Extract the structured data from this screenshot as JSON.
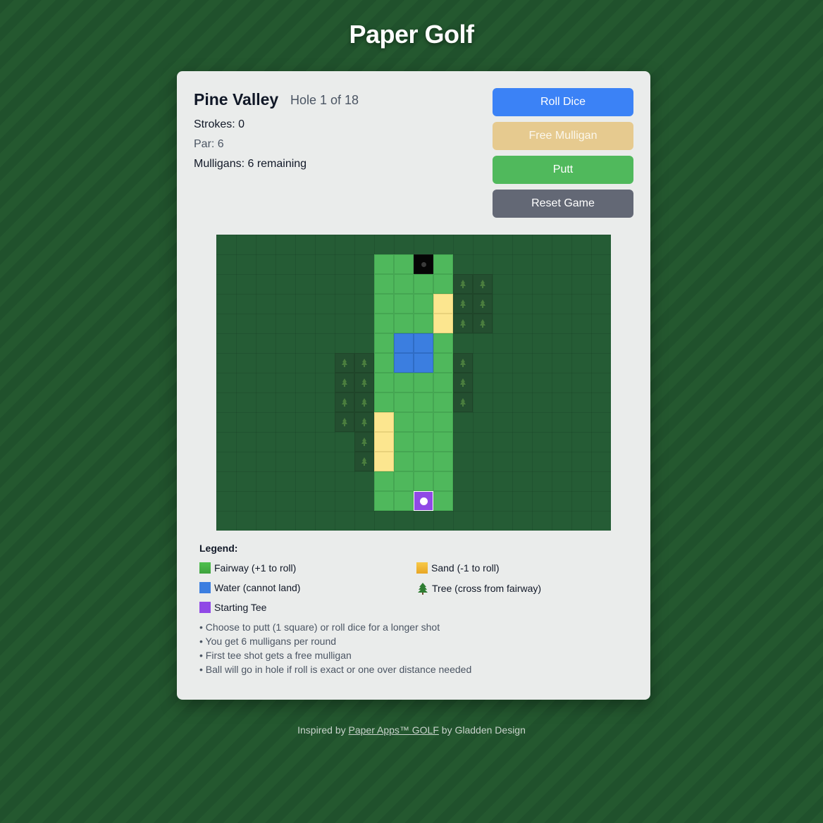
{
  "app": {
    "title": "Paper Golf"
  },
  "course": {
    "name": "Pine Valley",
    "hole_info": "Hole 1 of 18"
  },
  "stats": {
    "strokes": "Strokes: 0",
    "par": "Par: 6",
    "mulligans": "Mulligans: 6 remaining"
  },
  "buttons": {
    "roll": "Roll Dice",
    "mulligan": "Free Mulligan",
    "putt": "Putt",
    "reset": "Reset Game"
  },
  "colors": {
    "fairway": "#4fb85c",
    "sand": "#fce68f",
    "water": "#3b7ee0",
    "tree": "#244f30",
    "hole": "#050505",
    "tee": "#9049e6",
    "rough": "#255c35"
  },
  "board": {
    "cols": 20,
    "rows": 15,
    "grid": [
      "....................",
      "........FFHF........",
      "........FFFFTT......",
      "........FFFSTT......",
      "........FFFSTT......",
      "........FWWF........",
      "......TTFWWFT.......",
      "......TTFFFFT.......",
      "......TTFFFFT.......",
      "......TTSFFF........",
      ".......TSFFF........",
      ".......TSFFF........",
      "........FFFF........",
      "........FFEF........",
      "...................."
    ],
    "tree_icon": "tree-icon"
  },
  "legend": {
    "title": "Legend:",
    "fairway": "Fairway (+1 to roll)",
    "sand": "Sand (-1 to roll)",
    "water": "Water (cannot land)",
    "tree": "Tree (cross from fairway)",
    "tee": "Starting Tee"
  },
  "rules": [
    "• Choose to putt (1 square) or roll dice for a longer shot",
    "• You get 6 mulligans per round",
    "• First tee shot gets a free mulligan",
    "• Ball will go in hole if roll is exact or one over distance needed"
  ],
  "footer": {
    "prefix": "Inspired by ",
    "link": "Paper Apps™ GOLF",
    "suffix": " by Gladden Design"
  }
}
